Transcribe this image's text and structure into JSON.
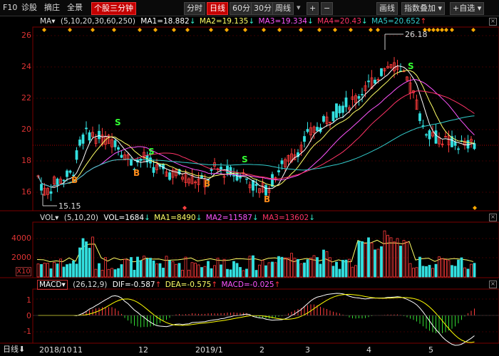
{
  "toolbar": {
    "f10": "F10",
    "diagnose": "诊股",
    "extract": "摘庄",
    "fullview": "全景",
    "stock3min": "个股三分钟",
    "period_tabs": [
      "分时",
      "日线",
      "60分",
      "30分",
      "周线"
    ],
    "plus": "+",
    "minus": "−",
    "draw": "画线",
    "index_overlay": "指数叠加",
    "add_favorite": "+自选"
  },
  "ma_bar": {
    "label": "MA",
    "params": "(5,10,20,30,60,250)",
    "ma1": "MA1=18.882",
    "ma2": "MA2=19.135",
    "ma3": "MA3=19.334",
    "ma4": "MA4=20.43",
    "ma5": "MA5=20.652"
  },
  "vol_bar": {
    "label": "VOL",
    "params": "(5,10,20)",
    "vol": "VOL=1684",
    "ma1": "MA1=8490",
    "ma2": "MA2=11587",
    "ma3": "MA3=13602"
  },
  "macd_bar": {
    "label": "MACD",
    "params": "(26,12,9)",
    "dif": "DIF=-0.587",
    "dea": "DEA=-0.575",
    "macd": "MACD=-0.025"
  },
  "price_axis": [
    "26",
    "24",
    "22",
    "20",
    "18",
    "16"
  ],
  "vol_axis": [
    "4000",
    "2000"
  ],
  "vol_unit": "X10",
  "macd_axis": [
    "1",
    "0",
    "-1"
  ],
  "annotations": {
    "high": "26.18",
    "low": "15.15",
    "buy": "B",
    "sell": "S"
  },
  "date_ticks": [
    "2018/10",
    "11",
    "12",
    "2019/1",
    "2",
    "3",
    "4",
    "5"
  ],
  "bottom_label": "日线",
  "colors": {
    "up": "#ff3b3b",
    "down": "#33e0e0",
    "ma5": "#ffffff",
    "ma10": "#ffff66",
    "ma20": "#ff55ff",
    "ma30": "#ff3366",
    "ma60": "#33cccc",
    "dif": "#ffffff",
    "dea": "#ffff00",
    "signal_s": "#33ff33",
    "signal_b": "#ff8c1a"
  }
}
